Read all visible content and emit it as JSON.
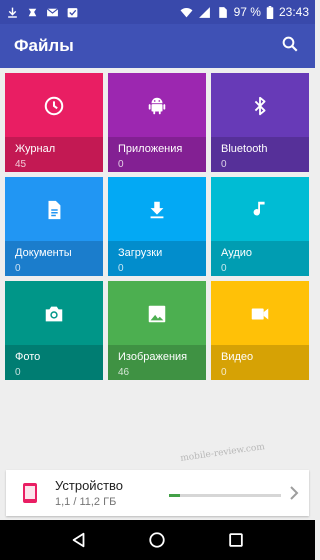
{
  "status_bar": {
    "battery_percent": "97 %",
    "time": "23:43",
    "left_icons": [
      "download-icon",
      "swiftkey-icon",
      "gmail-icon",
      "tasks-check-icon"
    ],
    "right_icons": [
      "wifi-icon",
      "signal-icon",
      "sim-icon",
      "battery-icon"
    ]
  },
  "app_bar": {
    "title": "Файлы",
    "action_icon": "search-icon"
  },
  "categories": [
    {
      "label": "Журнал",
      "count": "45",
      "icon": "clock-icon",
      "color": "#e91e63"
    },
    {
      "label": "Приложения",
      "count": "0",
      "icon": "android-icon",
      "color": "#9c27b0"
    },
    {
      "label": "Bluetooth",
      "count": "0",
      "icon": "bluetooth-icon",
      "color": "#673ab7"
    },
    {
      "label": "Документы",
      "count": "0",
      "icon": "document-icon",
      "color": "#2196f3"
    },
    {
      "label": "Загрузки",
      "count": "0",
      "icon": "download-icon",
      "color": "#03a9f4"
    },
    {
      "label": "Аудио",
      "count": "0",
      "icon": "music-note-icon",
      "color": "#00bcd4"
    },
    {
      "label": "Фото",
      "count": "0",
      "icon": "camera-icon",
      "color": "#009688"
    },
    {
      "label": "Изображения",
      "count": "46",
      "icon": "image-icon",
      "color": "#4caf50"
    },
    {
      "label": "Видео",
      "count": "0",
      "icon": "videocam-icon",
      "color": "#ffc107"
    }
  ],
  "device": {
    "title": "Устройство",
    "usage": "1,1 / 11,2 ГБ",
    "used_fraction": 0.098,
    "icon": "phone-icon",
    "accent": "#e91e63",
    "progress_color": "#43a047"
  },
  "watermark": "mobile-review.com",
  "nav": {
    "icons": [
      "back-icon",
      "home-icon",
      "recents-icon"
    ]
  },
  "colors": {
    "status_bar": "#3949ab",
    "app_bar": "#3f51b5",
    "background": "#eeeeee"
  }
}
